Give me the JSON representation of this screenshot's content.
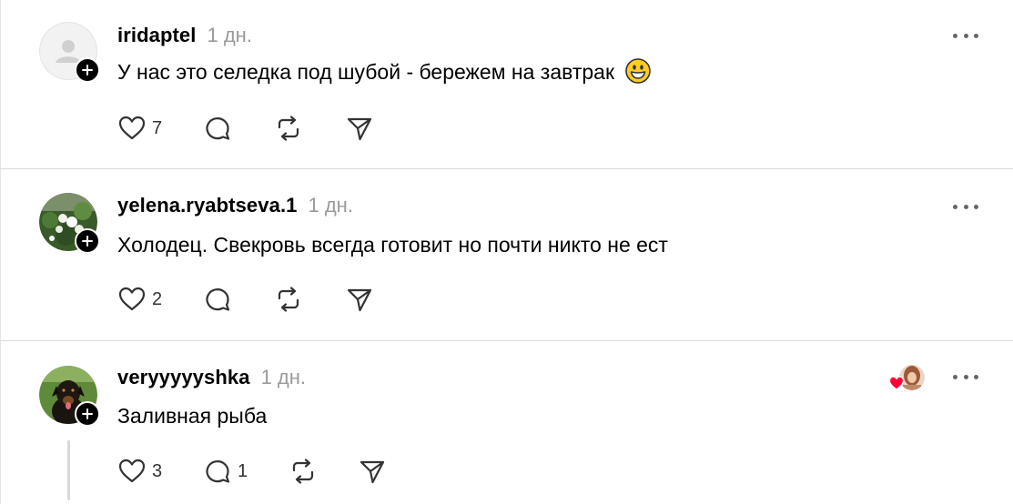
{
  "posts": [
    {
      "username": "iridaptel",
      "time": "1 дн.",
      "text": "У нас это селедка под шубой - бережем на завтрак",
      "emoji": "grinning-face",
      "likes": "7",
      "replies": "",
      "avatar": "default-avatar"
    },
    {
      "username": "yelena.ryabtseva.1",
      "time": "1 дн.",
      "text": "Холодец. Свекровь всегда готовит но почти никто не ест",
      "likes": "2",
      "replies": "",
      "avatar": "flowers-photo"
    },
    {
      "username": "veryyyyyshka",
      "time": "1 дн.",
      "text": "Заливная рыба",
      "likes": "3",
      "replies": "1",
      "avatar": "dog-photo",
      "liked_by_author": true
    }
  ],
  "colors": {
    "text": "#000000",
    "muted": "#9a9a9a",
    "divider": "#dcdcdc",
    "heart": "#ff0034"
  }
}
